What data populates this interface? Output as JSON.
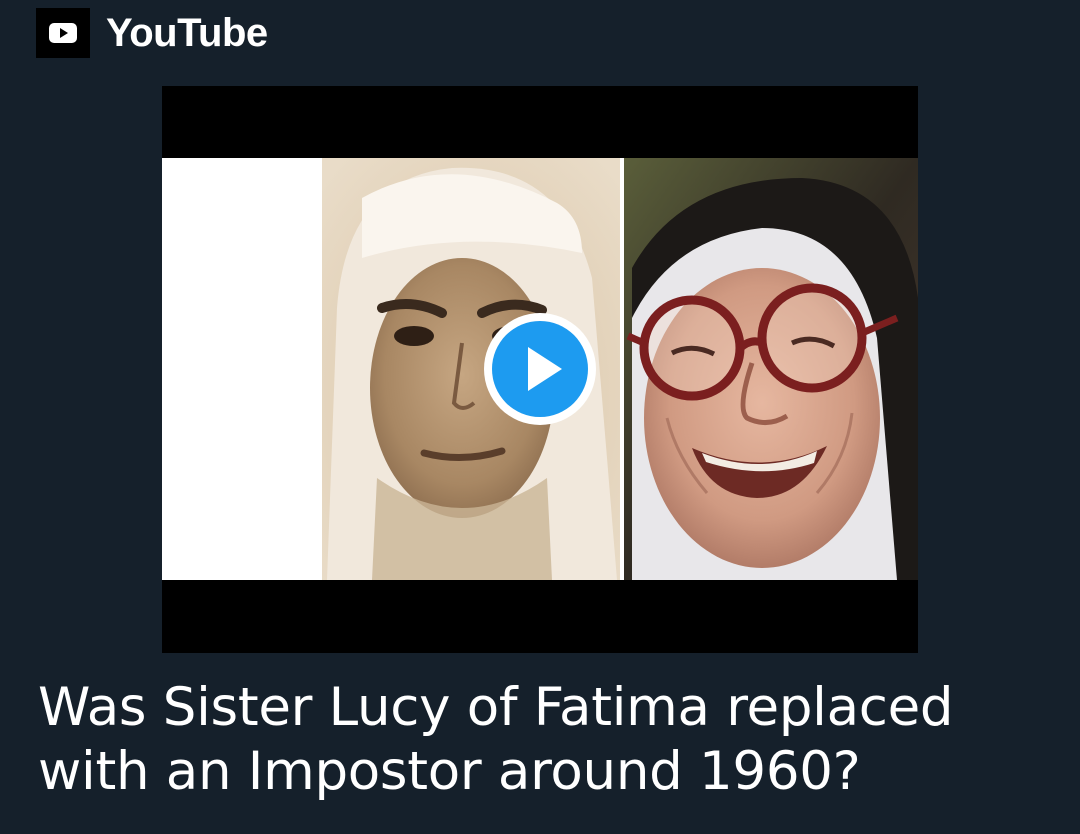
{
  "header": {
    "icon": "youtube-play-icon",
    "source_label": "YouTube"
  },
  "video": {
    "thumbnail": "side-by-side portraits of a young nun and an elderly nun wearing glasses",
    "play_icon": "play-icon",
    "accent_color": "#1d9bf0"
  },
  "card": {
    "title": "Was Sister Lucy of Fatima replaced with an Impostor around 1960?"
  },
  "colors": {
    "background": "#15202b",
    "text": "#ffffff"
  }
}
